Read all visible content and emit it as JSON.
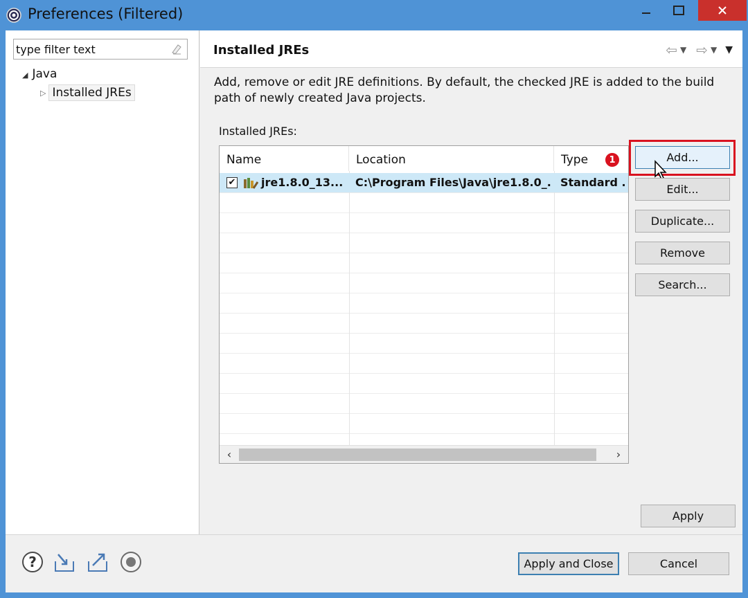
{
  "window": {
    "title": "Preferences (Filtered)"
  },
  "left": {
    "filter": {
      "value": "type filter text",
      "placeholder": "type filter text"
    },
    "tree": {
      "java": "Java",
      "installed_jres": "Installed JREs"
    }
  },
  "right": {
    "page_title": "Installed JREs",
    "description": "Add, remove or edit JRE definitions. By default, the checked JRE is added to the build path of newly created Java projects.",
    "table_label": "Installed JREs:",
    "table": {
      "columns": [
        "Name",
        "Location",
        "Type"
      ],
      "rows": [
        {
          "checked": true,
          "name": "jre1.8.0_13...",
          "location": "C:\\Program Files\\Java\\jre1.8.0_...",
          "type": "Standard ..."
        }
      ]
    },
    "badge": "1",
    "buttons": {
      "add": "Add...",
      "edit": "Edit...",
      "duplicate": "Duplicate...",
      "remove": "Remove",
      "search": "Search...",
      "apply": "Apply"
    }
  },
  "footer": {
    "apply_and_close": "Apply and Close",
    "cancel": "Cancel",
    "icons": [
      "help-icon",
      "import-icon",
      "export-icon",
      "record-icon"
    ]
  },
  "colors": {
    "title_bar": "#4f93d6",
    "close_button": "#c9302c",
    "selection": "#cde8f7",
    "highlight": "#d9121f"
  }
}
